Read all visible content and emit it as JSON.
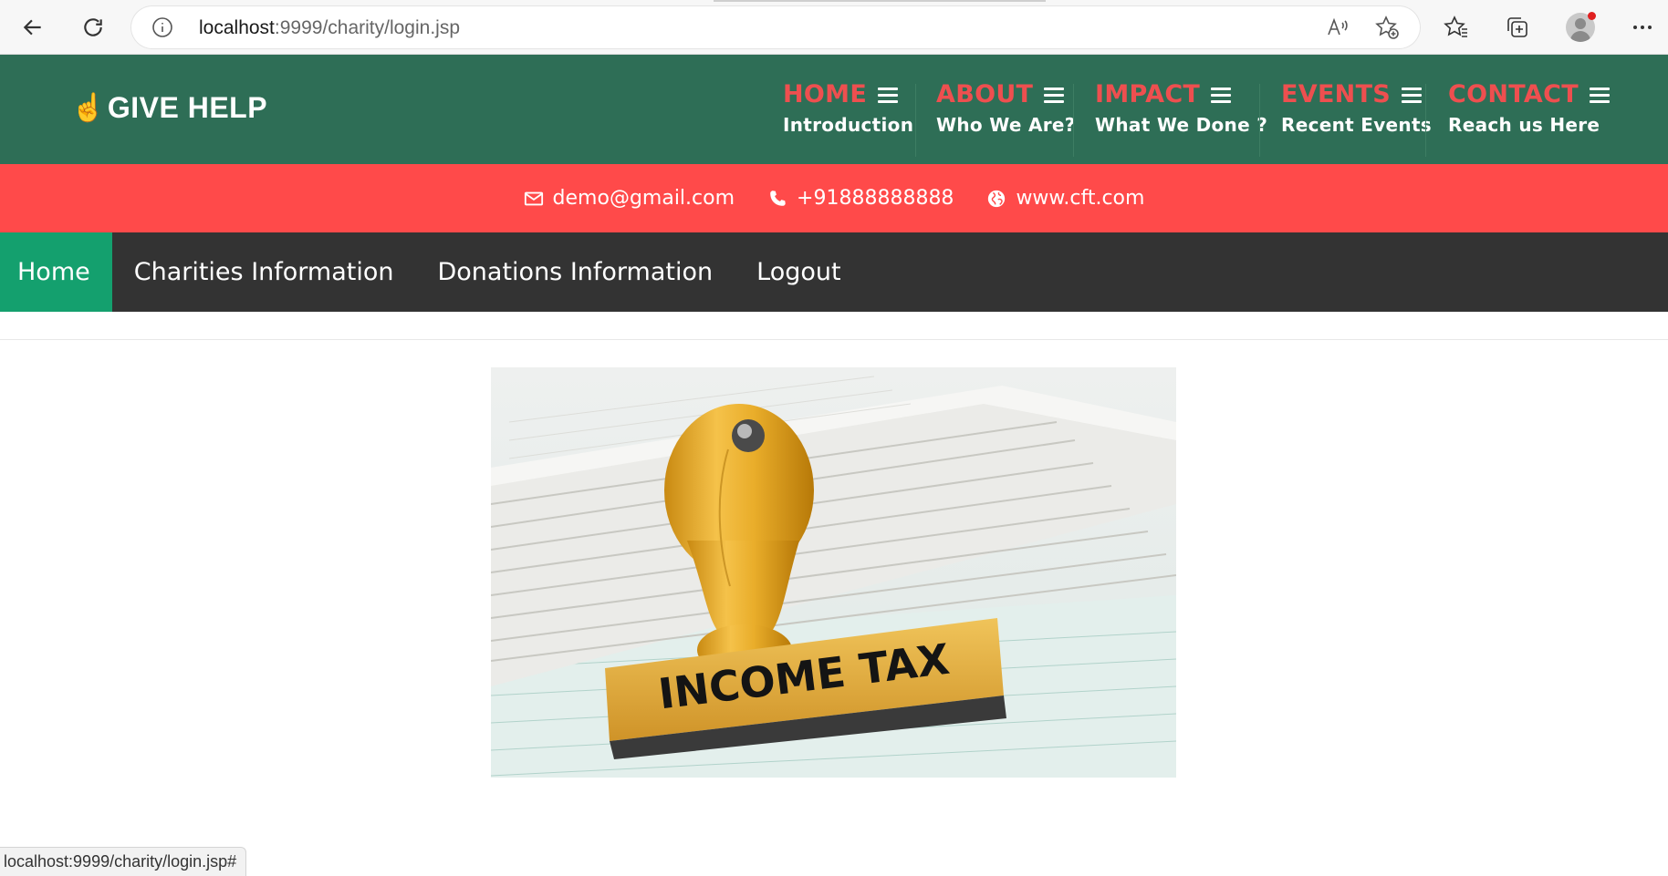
{
  "browser": {
    "url_host": "localhost",
    "url_rest": ":9999/charity/login.jsp",
    "status_url": "localhost:9999/charity/login.jsp#"
  },
  "header": {
    "logo_text": "GIVE HELP",
    "logo_icon": "pointing-hand-icon",
    "menu": [
      {
        "title": "HOME",
        "sub": "Introduction"
      },
      {
        "title": "ABOUT",
        "sub": "Who We Are?"
      },
      {
        "title": "IMPACT",
        "sub": "What We Done ?"
      },
      {
        "title": "EVENTS",
        "sub": "Recent Events"
      },
      {
        "title": "CONTACT",
        "sub": "Reach us Here"
      }
    ]
  },
  "contact": {
    "email": "demo@gmail.com",
    "phone": "+91888888888",
    "website": "www.cft.com"
  },
  "nav": {
    "items": [
      "Home",
      "Charities Information",
      "Donations Information",
      "Logout"
    ],
    "active": "Home"
  },
  "hero": {
    "stamp_text": "INCOME TAX"
  },
  "colors": {
    "header_bg": "#2e6e56",
    "menu_title": "#ee4f4f",
    "contact_bar": "#ff4a4a",
    "nav_bg": "#333333",
    "nav_active": "#14a06e"
  }
}
